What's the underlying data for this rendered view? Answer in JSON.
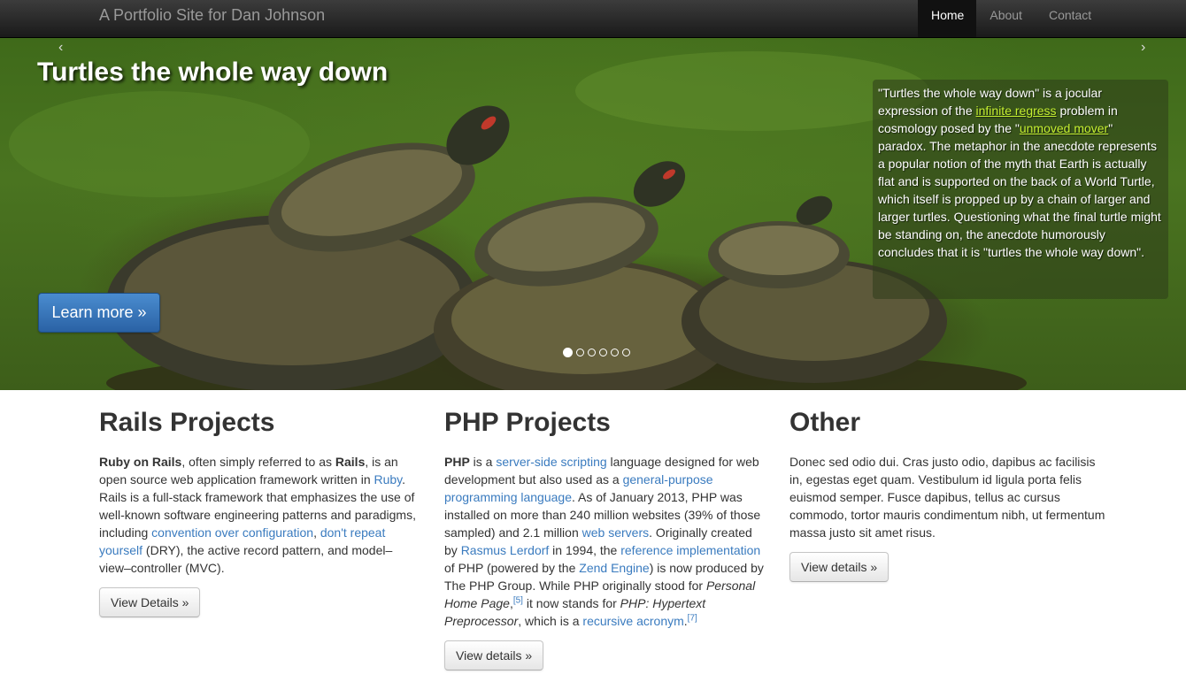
{
  "navbar": {
    "brand": "A Portfolio Site for Dan Johnson",
    "items": [
      {
        "label": "Home",
        "active": true
      },
      {
        "label": "About",
        "active": false
      },
      {
        "label": "Contact",
        "active": false
      }
    ]
  },
  "carousel": {
    "prev_icon": "‹",
    "next_icon": "›",
    "title": "Turtles the whole way down",
    "caption": {
      "t1": "\"Turtles the whole way down\" is a jocular expression of the ",
      "link1": "infinite regress",
      "t2": " problem in cosmology posed by the \"",
      "link2": "unmoved mover",
      "t3": "\" paradox. The metaphor in the anecdote represents a popular notion of the myth that Earth is actually flat and is supported on the back of a World Turtle, which itself is propped up by a chain of larger and larger turtles. Questioning what the final turtle might be standing on, the anecdote humorously concludes that it is \"turtles the whole way down\"."
    },
    "button_label": "Learn more »",
    "slide_count": 6,
    "active_slide": 1
  },
  "columns": {
    "rails": {
      "heading": "Rails Projects",
      "b1": "Ruby on Rails",
      "t1": ", often simply referred to as ",
      "b2": "Rails",
      "t2": ", is an open source web application framework written in ",
      "l1": "Ruby",
      "t3": ". Rails is a full-stack framework that emphasizes the use of well-known software engineering patterns and paradigms, including ",
      "l2": "convention over configuration",
      "t4": ", ",
      "l3": "don't repeat yourself",
      "t5": " (DRY), the active record pattern, and model–view–controller (MVC).",
      "button": "View Details »"
    },
    "php": {
      "heading": "PHP Projects",
      "b1": "PHP",
      "t1": " is a ",
      "l1": "server-side scripting",
      "t2": " language designed for web development but also used as a ",
      "l2": "general-purpose programming language",
      "t3": ". As of January 2013, PHP was installed on more than 240 million websites (39% of those sampled) and 2.1 million ",
      "l3": "web servers",
      "t4": ". Originally created by ",
      "l4": "Rasmus Lerdorf",
      "t5": " in 1994, the ",
      "l5": "reference implementation",
      "t6": " of PHP (powered by the ",
      "l6": "Zend Engine",
      "t7": ") is now produced by The PHP Group. While PHP originally stood for ",
      "i1": "Personal Home Page",
      "t8": ",",
      "s1": "[5]",
      "t9": " it now stands for ",
      "i2": "PHP: Hypertext Preprocessor",
      "t10": ", which is a ",
      "l7": "recursive acronym",
      "t11": ".",
      "s2": "[7]",
      "button": "View details »"
    },
    "other": {
      "heading": "Other",
      "text": "Donec sed odio dui. Cras justo odio, dapibus ac facilisis in, egestas eget quam. Vestibulum id ligula porta felis euismod semper. Fusce dapibus, tellus ac cursus commodo, tortor mauris condimentum nibh, ut fermentum massa justo sit amet risus.",
      "button": "View details »"
    }
  }
}
